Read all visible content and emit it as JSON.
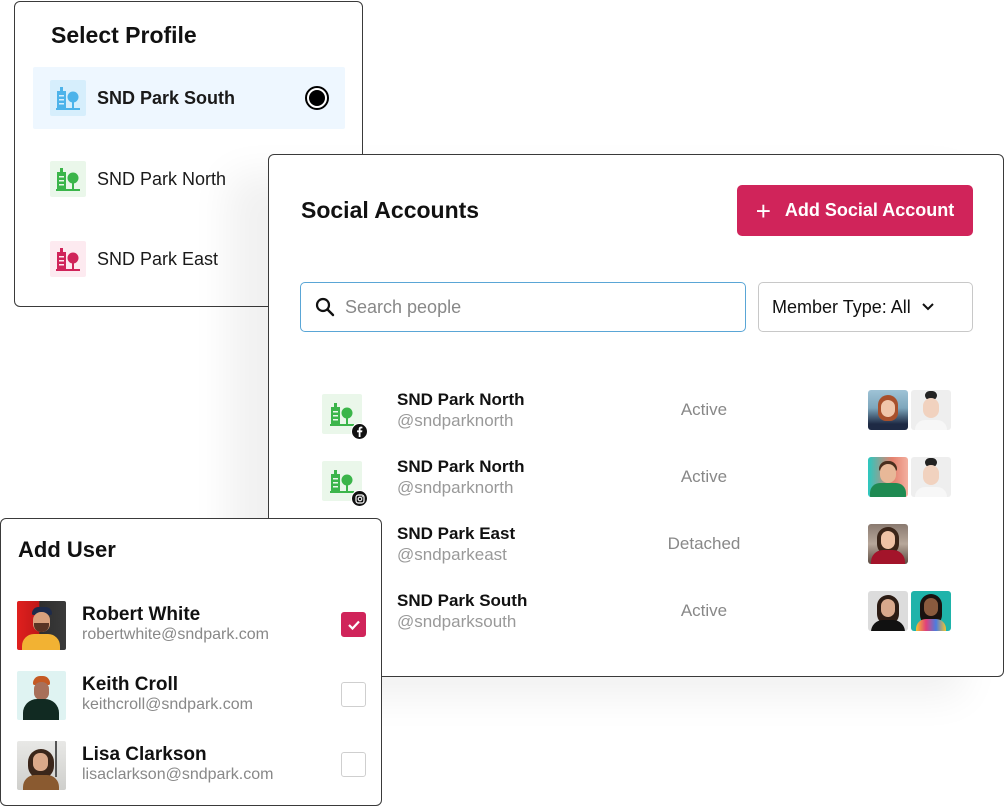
{
  "select_profile": {
    "title": "Select Profile",
    "items": [
      {
        "label": "SND Park South",
        "icon": "building-tree-icon",
        "icon_color": "#4db3ea",
        "bg_color": "#d6eefc",
        "selected": true
      },
      {
        "label": "SND Park North",
        "icon": "building-tree-icon",
        "icon_color": "#3bb54a",
        "bg_color": "#eaf7ea",
        "selected": false
      },
      {
        "label": "SND Park East",
        "icon": "building-tree-icon",
        "icon_color": "#d0245a",
        "bg_color": "#fdeaf0",
        "selected": false
      }
    ]
  },
  "social_accounts": {
    "title": "Social Accounts",
    "add_button": {
      "icon": "plus-icon",
      "label": "Add Social Account"
    },
    "search": {
      "placeholder": "Search people",
      "value": "",
      "icon": "search-icon"
    },
    "member_type": {
      "label": "Member Type: All",
      "icon": "chevron-down-icon"
    },
    "rows": [
      {
        "name": "SND Park North",
        "handle": "@sndparknorth",
        "status": "Active",
        "network": "facebook",
        "members": [
          "redhead-woman",
          "smiling-woman-bun"
        ]
      },
      {
        "name": "SND Park North",
        "handle": "@sndparknorth",
        "status": "Active",
        "network": "instagram",
        "members": [
          "man-green-jacket",
          "smiling-woman-bun"
        ]
      },
      {
        "name": "SND Park East",
        "handle": "@sndparkeast",
        "status": "Detached",
        "network": "",
        "members": [
          "woman-red-sweater"
        ]
      },
      {
        "name": "SND Park South",
        "handle": "@sndparksouth",
        "status": "Active",
        "network": "",
        "members": [
          "woman-black-top",
          "woman-colorful-dress"
        ]
      }
    ]
  },
  "add_user": {
    "title": "Add User",
    "users": [
      {
        "name": "Robert White",
        "email": "robertwhite@sndpark.com",
        "checked": true
      },
      {
        "name": "Keith Croll",
        "email": "keithcroll@sndpark.com",
        "checked": false
      },
      {
        "name": "Lisa Clarkson",
        "email": "lisaclarkson@sndpark.com",
        "checked": false
      }
    ]
  },
  "colors": {
    "accent": "#d0245a",
    "search_border": "#5aa6d6",
    "selected_bg": "#eef7ff",
    "muted_text": "#888888"
  }
}
